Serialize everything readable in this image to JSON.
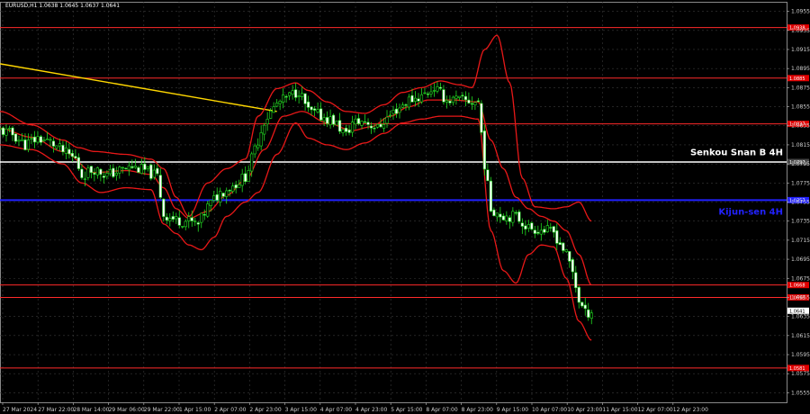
{
  "chart_data": {
    "type": "candlestick",
    "title": "EURUSD,H1  1.0638 1.0645 1.0637 1.0641",
    "ylim": [
      1.0545,
      1.0965
    ],
    "y_ticks": [
      "1.0955",
      "1.0935",
      "1.0915",
      "1.0895",
      "1.0875",
      "1.0855",
      "1.0835",
      "1.0815",
      "1.0795",
      "1.0775",
      "1.0755",
      "1.0735",
      "1.0715",
      "1.0695",
      "1.0675",
      "1.0655",
      "1.0635",
      "1.0615",
      "1.0595",
      "1.0575",
      "1.0555"
    ],
    "x_ticks": [
      "27 Mar 2024",
      "27 Mar 22:00",
      "28 Mar 14:00",
      "29 Mar 06:00",
      "29 Mar 22:00",
      "1 Apr 15:00",
      "2 Apr 07:00",
      "2 Apr 23:00",
      "3 Apr 15:00",
      "4 Apr 07:00",
      "4 Apr 23:00",
      "5 Apr 15:00",
      "8 Apr 07:00",
      "8 Apr 23:00",
      "9 Apr 15:00",
      "10 Apr 07:00",
      "10 Apr 23:00",
      "11 Apr 15:00",
      "12 Apr 07:00",
      "12 Apr 23:00"
    ],
    "levels": [
      {
        "value": 1.0938,
        "color": "#ff2a2a",
        "label": "1.0938"
      },
      {
        "value": 1.0885,
        "color": "#ff2a2a",
        "label": "1.0885"
      },
      {
        "value": 1.0837,
        "color": "#ff2a2a",
        "label": "1.0837"
      },
      {
        "value": 1.0797,
        "color": "#ffffff",
        "label": "1.0797"
      },
      {
        "value": 1.0757,
        "color": "#2222ff",
        "label": "1.0757"
      },
      {
        "value": 1.0668,
        "color": "#ff2a2a",
        "label": "1.0668"
      },
      {
        "value": 1.0655,
        "color": "#ff2a2a",
        "label": "1.0655"
      },
      {
        "value": 1.0581,
        "color": "#ff2a2a",
        "label": "1.0581"
      }
    ],
    "current_price": "1.0641",
    "annotations": [
      {
        "text": "Senkou Snan B 4H",
        "color": "#ffffff",
        "level": 1.0804
      },
      {
        "text": "Kijun-sen 4H",
        "color": "#2222ff",
        "level": 1.0742
      }
    ],
    "trend_line": {
      "from": [
        0,
        1.09
      ],
      "to": [
        88,
        1.085
      ],
      "color": "#ffd700"
    },
    "close_path": [
      [
        0,
        1.083
      ],
      [
        4,
        1.0826
      ],
      [
        8,
        1.0815
      ],
      [
        12,
        1.0822
      ],
      [
        16,
        1.0818
      ],
      [
        20,
        1.0808
      ],
      [
        24,
        1.08
      ],
      [
        26,
        1.0783
      ],
      [
        30,
        1.079
      ],
      [
        34,
        1.0783
      ],
      [
        38,
        1.0788
      ],
      [
        42,
        1.0792
      ],
      [
        46,
        1.0788
      ],
      [
        50,
        1.0782
      ],
      [
        52,
        1.0742
      ],
      [
        56,
        1.0736
      ],
      [
        60,
        1.0735
      ],
      [
        63,
        1.0731
      ],
      [
        66,
        1.075
      ],
      [
        70,
        1.0765
      ],
      [
        74,
        1.0772
      ],
      [
        78,
        1.0782
      ],
      [
        80,
        1.08
      ],
      [
        84,
        1.084
      ],
      [
        88,
        1.0858
      ],
      [
        92,
        1.0866
      ],
      [
        95,
        1.0872
      ],
      [
        98,
        1.085
      ],
      [
        102,
        1.0845
      ],
      [
        106,
        1.084
      ],
      [
        110,
        1.0825
      ],
      [
        112,
        1.0838
      ],
      [
        116,
        1.084
      ],
      [
        120,
        1.0832
      ],
      [
        122,
        1.084
      ],
      [
        126,
        1.0852
      ],
      [
        130,
        1.0862
      ],
      [
        134,
        1.0866
      ],
      [
        138,
        1.0875
      ],
      [
        142,
        1.0862
      ],
      [
        146,
        1.0862
      ],
      [
        150,
        1.086
      ],
      [
        152,
        1.086
      ],
      [
        154,
        1.0795
      ],
      [
        156,
        1.0748
      ],
      [
        160,
        1.0741
      ],
      [
        164,
        1.074
      ],
      [
        168,
        1.0728
      ],
      [
        172,
        1.0726
      ],
      [
        176,
        1.0723
      ],
      [
        180,
        1.07
      ],
      [
        182,
        1.0682
      ],
      [
        184,
        1.0652
      ],
      [
        186,
        1.0638
      ],
      [
        188,
        1.0641
      ]
    ],
    "bb_upper": [
      [
        0,
        1.085
      ],
      [
        10,
        1.0836
      ],
      [
        20,
        1.082
      ],
      [
        25,
        1.0812
      ],
      [
        30,
        1.0808
      ],
      [
        40,
        1.0805
      ],
      [
        48,
        1.08
      ],
      [
        52,
        1.079
      ],
      [
        56,
        1.076
      ],
      [
        60,
        1.074
      ],
      [
        66,
        1.0775
      ],
      [
        72,
        1.079
      ],
      [
        78,
        1.08
      ],
      [
        82,
        1.0845
      ],
      [
        88,
        1.0874
      ],
      [
        94,
        1.088
      ],
      [
        98,
        1.0872
      ],
      [
        104,
        1.086
      ],
      [
        110,
        1.085
      ],
      [
        116,
        1.0848
      ],
      [
        122,
        1.0857
      ],
      [
        128,
        1.087
      ],
      [
        134,
        1.0875
      ],
      [
        140,
        1.0882
      ],
      [
        146,
        1.0878
      ],
      [
        150,
        1.0875
      ],
      [
        154,
        1.0915
      ],
      [
        158,
        1.093
      ],
      [
        162,
        1.088
      ],
      [
        166,
        1.078
      ],
      [
        170,
        1.075
      ],
      [
        176,
        1.0748
      ],
      [
        180,
        1.075
      ],
      [
        184,
        1.0755
      ],
      [
        188,
        1.0735
      ]
    ],
    "bb_lower": [
      [
        0,
        1.0815
      ],
      [
        10,
        1.081
      ],
      [
        20,
        1.0795
      ],
      [
        26,
        1.0775
      ],
      [
        32,
        1.0765
      ],
      [
        40,
        1.077
      ],
      [
        48,
        1.0768
      ],
      [
        52,
        1.0732
      ],
      [
        56,
        1.0722
      ],
      [
        60,
        1.071
      ],
      [
        64,
        1.0705
      ],
      [
        68,
        1.0718
      ],
      [
        72,
        1.074
      ],
      [
        78,
        1.0755
      ],
      [
        82,
        1.0765
      ],
      [
        88,
        1.0805
      ],
      [
        94,
        1.0838
      ],
      [
        98,
        1.0822
      ],
      [
        104,
        1.0815
      ],
      [
        110,
        1.081
      ],
      [
        116,
        1.0817
      ],
      [
        122,
        1.0827
      ],
      [
        128,
        1.0838
      ],
      [
        134,
        1.0842
      ],
      [
        140,
        1.0845
      ],
      [
        146,
        1.0845
      ],
      [
        152,
        1.0842
      ],
      [
        156,
        1.0725
      ],
      [
        160,
        1.0683
      ],
      [
        164,
        1.067
      ],
      [
        168,
        1.07
      ],
      [
        172,
        1.071
      ],
      [
        176,
        1.0708
      ],
      [
        180,
        1.0675
      ],
      [
        184,
        1.063
      ],
      [
        188,
        1.061
      ]
    ],
    "bb_middle": [
      [
        0,
        1.0832
      ],
      [
        10,
        1.0823
      ],
      [
        20,
        1.0808
      ],
      [
        30,
        1.0786
      ],
      [
        40,
        1.0788
      ],
      [
        48,
        1.0784
      ],
      [
        52,
        1.077
      ],
      [
        56,
        1.0748
      ],
      [
        60,
        1.0738
      ],
      [
        66,
        1.0745
      ],
      [
        72,
        1.0762
      ],
      [
        78,
        1.0778
      ],
      [
        84,
        1.081
      ],
      [
        90,
        1.0845
      ],
      [
        96,
        1.085
      ],
      [
        104,
        1.0838
      ],
      [
        112,
        1.083
      ],
      [
        118,
        1.0834
      ],
      [
        124,
        1.0845
      ],
      [
        130,
        1.0855
      ],
      [
        136,
        1.0862
      ],
      [
        144,
        1.0862
      ],
      [
        152,
        1.086
      ],
      [
        156,
        1.082
      ],
      [
        160,
        1.079
      ],
      [
        164,
        1.076
      ],
      [
        168,
        1.0748
      ],
      [
        172,
        1.074
      ],
      [
        176,
        1.0735
      ],
      [
        180,
        1.0725
      ],
      [
        184,
        1.07
      ],
      [
        188,
        1.0668
      ]
    ]
  }
}
